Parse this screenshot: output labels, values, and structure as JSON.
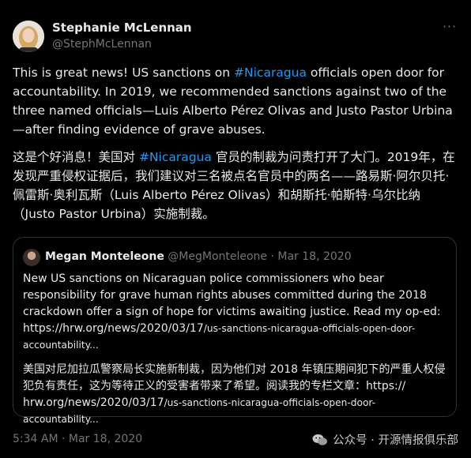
{
  "tweet": {
    "author": {
      "name": "Stephanie McLennan",
      "handle": "@StephMcLennan",
      "avatar_icon": "profile-photo"
    },
    "more_icon": "ellipsis-icon",
    "text_en_1": "This is great news! US sanctions on ",
    "hashtag_en": "#Nicaragua",
    "text_en_2": " officials open door for accountability. In 2019, we recommended sanctions against two of the three named officials—Luis Alberto Pérez Olivas and Justo Pastor Urbina—after finding evidence of grave abuses.",
    "text_zh_1": "这是个好消息！美国对 ",
    "hashtag_zh": "#Nicaragua",
    "text_zh_2": " 官员的制裁为问责打开了大门。2019年，在发现严重侵权证据后，我们建议对三名被点名官员中的两名——路易斯·阿尔贝托·佩雷斯·奥利瓦斯（Luis Alberto Pérez Olivas）和胡斯托·帕斯特·乌尔比纳（Justo Pastor Urbina）实施制裁。",
    "timestamp": "5:34 AM · Mar 18, 2020"
  },
  "quote": {
    "author_name": "Megan Monteleone",
    "handle": "@MegMonteleone",
    "date": "· Mar 18, 2020",
    "text_en": "New US sanctions on Nicaraguan police commissioners who bear responsibility for grave human rights abuses committed during the 2018 crackdown offer a sign of hope for victims awaiting justice. Read my op-ed:",
    "url_en_host": "https://hrw.org/news/2020/03/17",
    "url_en_path": "/us-sanctions-nicaragua-officials-open-door-accountability...",
    "text_zh": "美国对尼加拉瓜警察局长实施新制裁，因为他们对 2018 年镇压期间犯下的严重人权侵犯负有责任，这为等待正义的受害者带来了希望。阅读我的专栏文章：https://",
    "url_zh_host": "hrw.org/news/2020/03/17",
    "url_zh_path": "/us-sanctions-nicaragua-officials-open-door-accountability..."
  },
  "watermark": {
    "icon": "wechat-icon",
    "text": "公众号 · 开源情报俱乐部"
  },
  "colors": {
    "background": "#000000",
    "text": "#e7e9ea",
    "secondary": "#71767b",
    "link": "#1d9bf0",
    "border": "#2f3336"
  }
}
